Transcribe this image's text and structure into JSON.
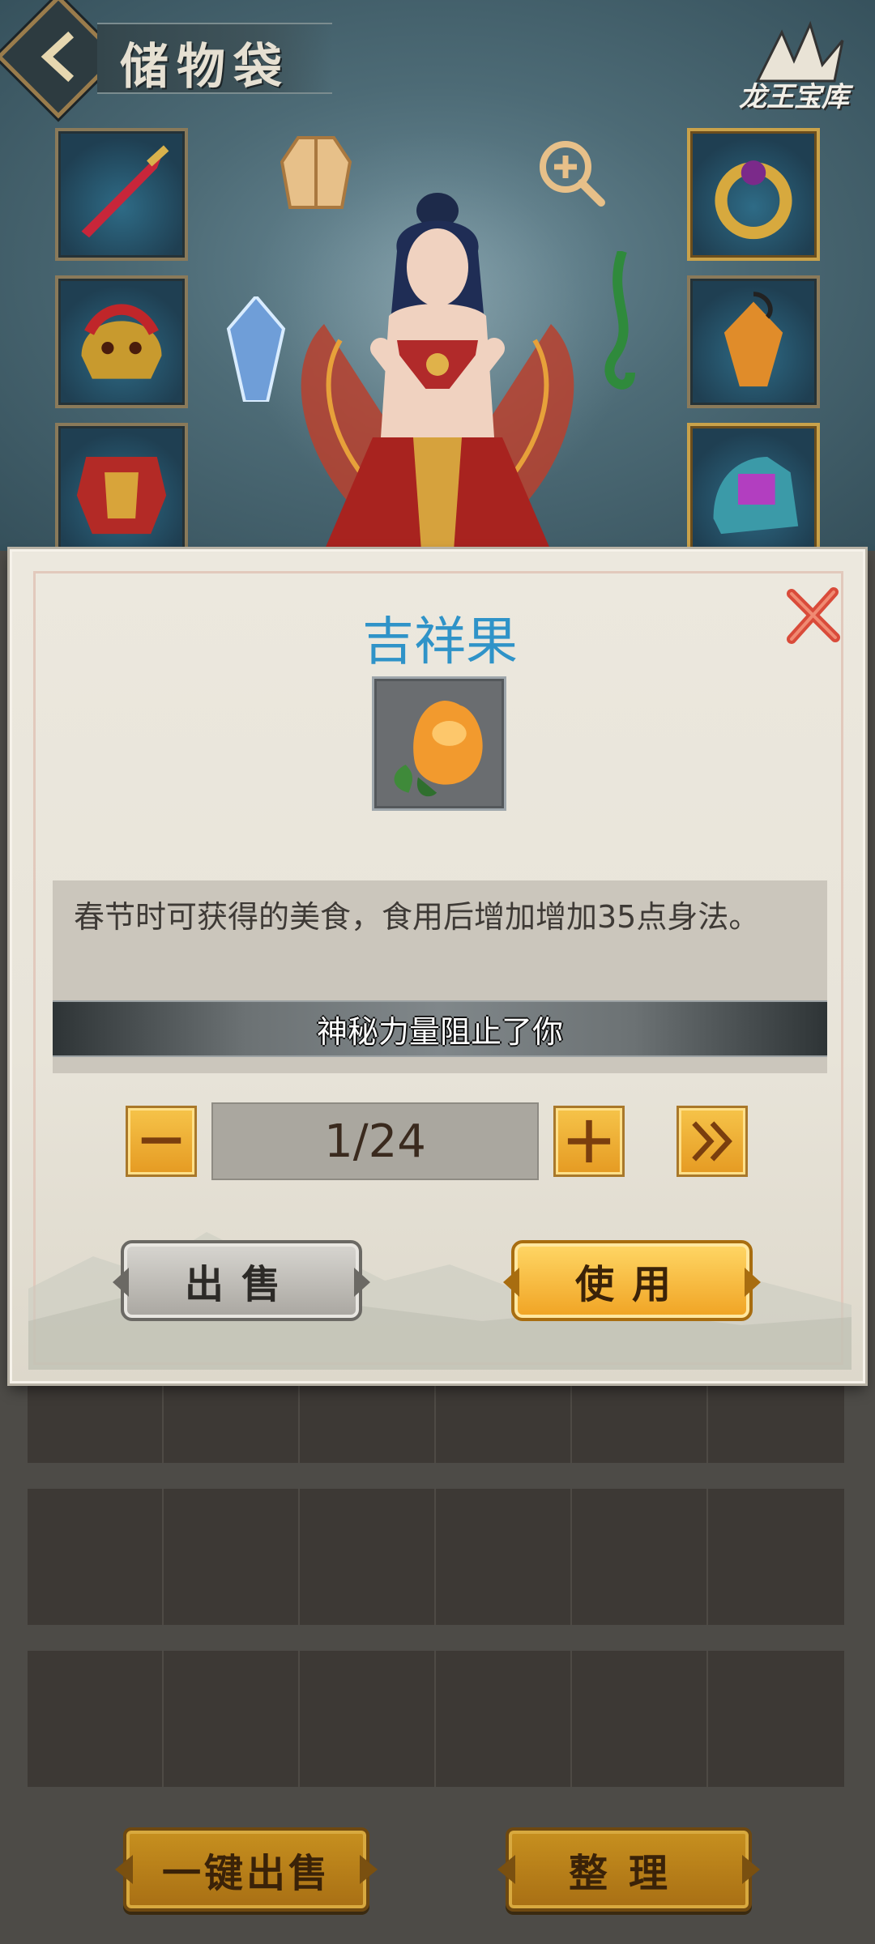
{
  "header": {
    "title": "储物袋",
    "brand": "龙王宝库"
  },
  "equipment": {
    "left_slots": [
      "sword-icon",
      "lion-helmet-icon",
      "red-armor-icon"
    ],
    "right_slots": [
      "gold-ring-icon",
      "amber-pendant-icon",
      "gem-boots-icon"
    ],
    "scene_icons": [
      "cloak-icon",
      "magnify-plus-icon",
      "crystal-icon",
      "jade-hook-icon"
    ]
  },
  "dialog": {
    "item_name": "吉祥果",
    "item_icon": "auspicious-fruit-icon",
    "description": "春节时可获得的美食，食用后增加增加35点身法。",
    "notice": "神秘力量阻止了你",
    "quantity": "1/24",
    "sell_label": "出售",
    "use_label": "使用"
  },
  "bottom": {
    "one_key_sell_label": "一键出售",
    "sort_label": "整理"
  },
  "colors": {
    "title_blue": "#2f93c8",
    "gold_button": "#f0a323",
    "close_red": "#d94b3a"
  }
}
